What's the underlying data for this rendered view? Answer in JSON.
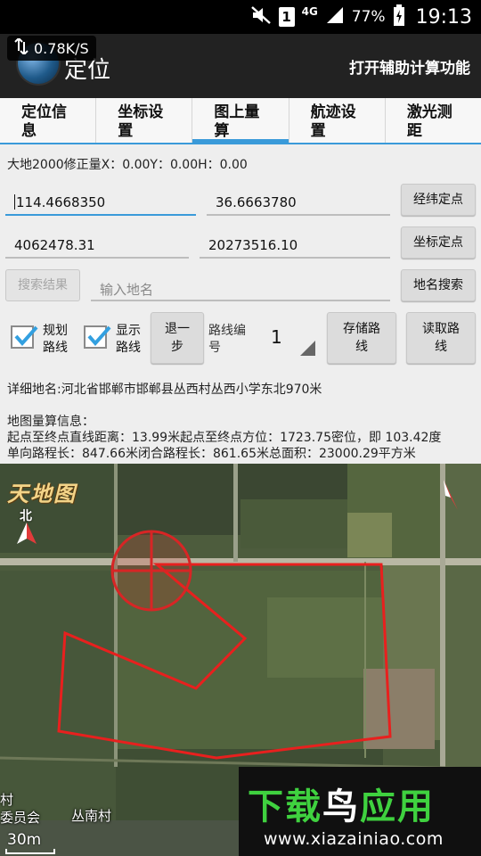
{
  "status_bar": {
    "network_speed": "0.78K/S",
    "sim_slot": "1",
    "network_type": "4G",
    "battery": "77%",
    "time": "19:13"
  },
  "action_bar": {
    "title": "定位",
    "action": "打开辅助计算功能"
  },
  "tabs": [
    {
      "line1": "定位信",
      "line2": "息"
    },
    {
      "line1": "坐标设",
      "line2": "置"
    },
    {
      "line1": "图上量",
      "line2": "算"
    },
    {
      "line1": "航迹设",
      "line2": "置"
    },
    {
      "line1": "激光测",
      "line2": "距"
    }
  ],
  "active_tab": 2,
  "correction": "大地2000修正量X：0.00Y：0.00H：0.00",
  "row_latlon": {
    "longitude": "114.4668350",
    "latitude": "36.6663780",
    "button": "经纬定点"
  },
  "row_coord": {
    "x": "4062478.31",
    "y": "20273516.10",
    "button": "坐标定点"
  },
  "row_search": {
    "results_button": "搜索结果",
    "placeholder": "输入地名",
    "button": "地名搜索"
  },
  "options": {
    "plan_route": {
      "line1": "规划",
      "line2": "路线",
      "checked": true
    },
    "show_route": {
      "line1": "显示",
      "line2": "路线",
      "checked": true
    },
    "back_step": {
      "line1": "退一",
      "line2": "步"
    },
    "route_number_label": {
      "line1": "路线编",
      "line2": "号"
    },
    "route_number": "1",
    "save_route": {
      "line1": "存储路",
      "line2": "线"
    },
    "load_route": {
      "line1": "读取路",
      "line2": "线"
    }
  },
  "address": "详细地名:河北省邯郸市邯郸县丛西村丛西小学东北970米",
  "calc": {
    "title": "地图量算信息：",
    "line1": "起点至终点直线距离：13.99米起点至终点方位：1723.75密位，即 103.42度",
    "line2": "单向路程长：847.66米闭合路程长：861.65米总面积：23000.29平方米"
  },
  "map": {
    "brand": "天地图",
    "north": "北",
    "place_village_left_1": "村",
    "place_village_left_2": "委员会",
    "place_village": "丛南村",
    "scale": "30m",
    "route_color": "#e8201e"
  },
  "watermark": {
    "part1": "下载",
    "part2": "鸟",
    "part3": "应用",
    "url": "www.xiazainiao.com"
  }
}
